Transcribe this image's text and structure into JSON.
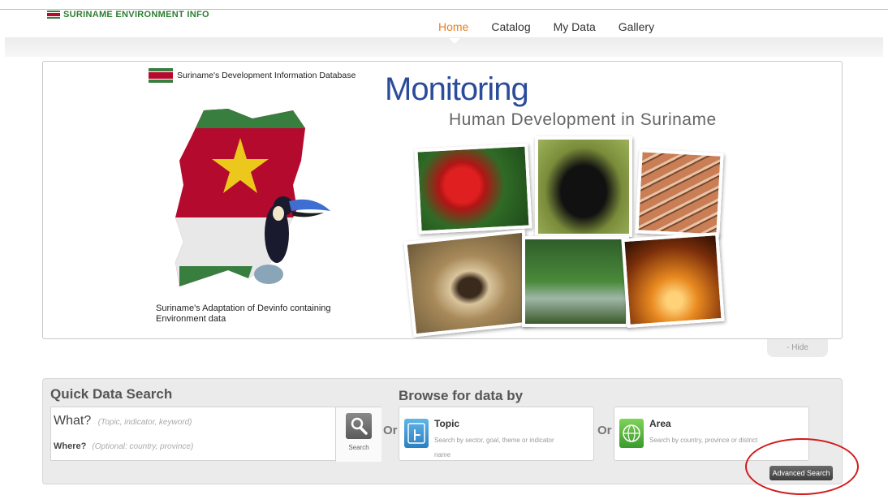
{
  "header": {
    "logo_text": "SURINAME ENVIRONMENT INFO",
    "nav": [
      {
        "label": "Home",
        "active": true
      },
      {
        "label": "Catalog",
        "active": false
      },
      {
        "label": "My Data",
        "active": false
      },
      {
        "label": "Gallery",
        "active": false
      }
    ]
  },
  "banner": {
    "subtitle": "Suriname's Development Information Database",
    "title": "Monitoring",
    "tagline": "Human Development in Suriname",
    "adaptation_line1": "Suriname's Adaptation of Devinfo containing",
    "adaptation_line2": "Environment data",
    "hide_label": "- Hide"
  },
  "quick_search": {
    "title": "Quick Data Search",
    "what_label": "What?",
    "what_placeholder": "(Topic, indicator, keyword)",
    "where_label": "Where?",
    "where_placeholder": "(Optional: country, province)",
    "search_label": "Search"
  },
  "browse": {
    "title": "Browse for data by",
    "or_label": "Or",
    "topic_title": "Topic",
    "topic_desc": "Search by sector, goal, theme or indicator name",
    "area_title": "Area",
    "area_desc": "Search by country, province or district"
  },
  "advanced_search_label": "Advanced Search",
  "colors": {
    "accent_active": "#e67e22",
    "title_blue": "#2b4c9b",
    "flag_green": "#377e3f",
    "flag_red": "#b40a2d",
    "flag_yellow": "#ecc81d",
    "annotation_red": "#d21a1a"
  },
  "icons": {
    "search": "search-icon",
    "topic": "topic-touch-icon",
    "area": "globe-icon"
  }
}
